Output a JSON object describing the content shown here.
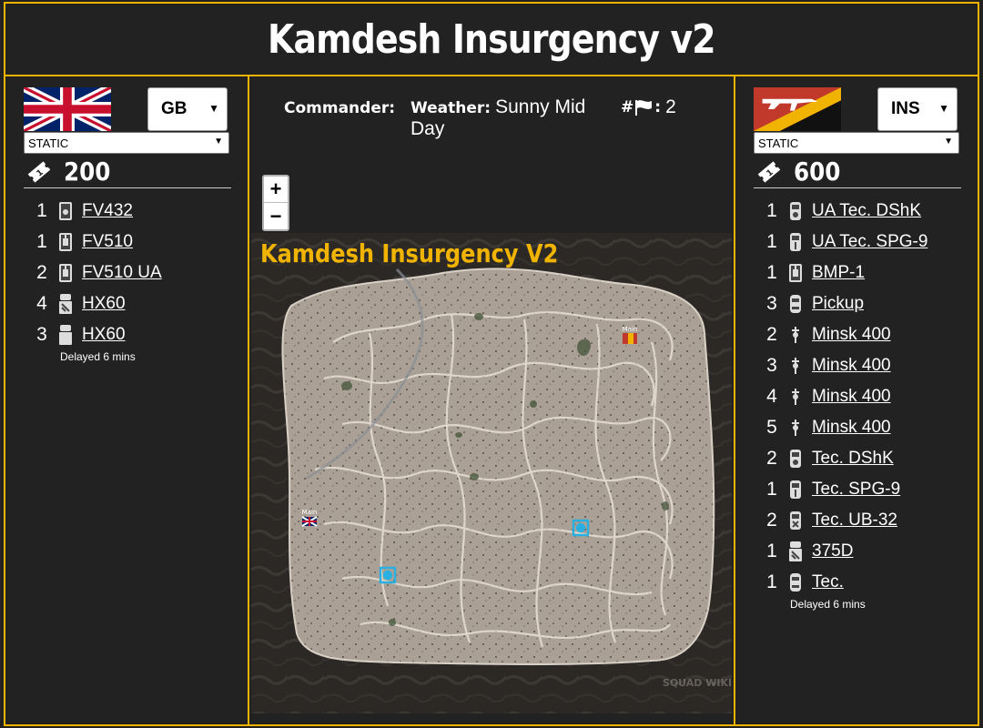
{
  "title": "Kamdesh Insurgency v2",
  "colors": {
    "accent": "#f0b400",
    "background": "#222222"
  },
  "team1": {
    "flag_icon": "united-kingdom-flag",
    "faction": "GB",
    "mode": "STATIC",
    "tickets": "200",
    "vehicles": [
      {
        "count": "1",
        "name": "FV432",
        "icon": "apc-icon"
      },
      {
        "count": "1",
        "name": "FV510",
        "icon": "ifv-icon"
      },
      {
        "count": "2",
        "name": "FV510 UA",
        "icon": "ifv-icon"
      },
      {
        "count": "4",
        "name": "HX60",
        "icon": "logistics-truck-icon"
      },
      {
        "count": "3",
        "name": "HX60",
        "icon": "transport-truck-icon"
      }
    ],
    "delay_note": "Delayed 6 mins"
  },
  "team2": {
    "flag_icon": "insurgent-flag",
    "faction": "INS",
    "mode": "STATIC",
    "tickets": "600",
    "vehicles": [
      {
        "count": "1",
        "name": "UA Tec. DShK",
        "icon": "technical-icon"
      },
      {
        "count": "1",
        "name": "UA Tec. SPG-9",
        "icon": "technical-icon"
      },
      {
        "count": "1",
        "name": "BMP-1",
        "icon": "ifv-icon"
      },
      {
        "count": "3",
        "name": "Pickup",
        "icon": "car-icon"
      },
      {
        "count": "2",
        "name": "Minsk 400",
        "icon": "motorcycle-icon"
      },
      {
        "count": "3",
        "name": "Minsk 400",
        "icon": "motorcycle-icon"
      },
      {
        "count": "4",
        "name": "Minsk 400",
        "icon": "motorcycle-icon"
      },
      {
        "count": "5",
        "name": "Minsk 400",
        "icon": "motorcycle-icon"
      },
      {
        "count": "2",
        "name": "Tec. DShK",
        "icon": "technical-icon"
      },
      {
        "count": "1",
        "name": "Tec. SPG-9",
        "icon": "technical-icon"
      },
      {
        "count": "2",
        "name": "Tec. UB-32",
        "icon": "technical-icon"
      },
      {
        "count": "1",
        "name": "375D",
        "icon": "logistics-truck-icon"
      },
      {
        "count": "1",
        "name": "Tec.",
        "icon": "car-icon"
      }
    ],
    "delay_note": "Delayed 6 mins"
  },
  "info": {
    "commander_label": "Commander:",
    "commander_value": "",
    "weather_label": "Weather:",
    "weather_value": "Sunny Mid Day",
    "flags_label": "#",
    "flags_value": "2"
  },
  "map": {
    "title": "Kamdesh Insurgency V2",
    "watermark": "SQUAD WIKI",
    "zoom_in": "+",
    "zoom_out": "−"
  }
}
